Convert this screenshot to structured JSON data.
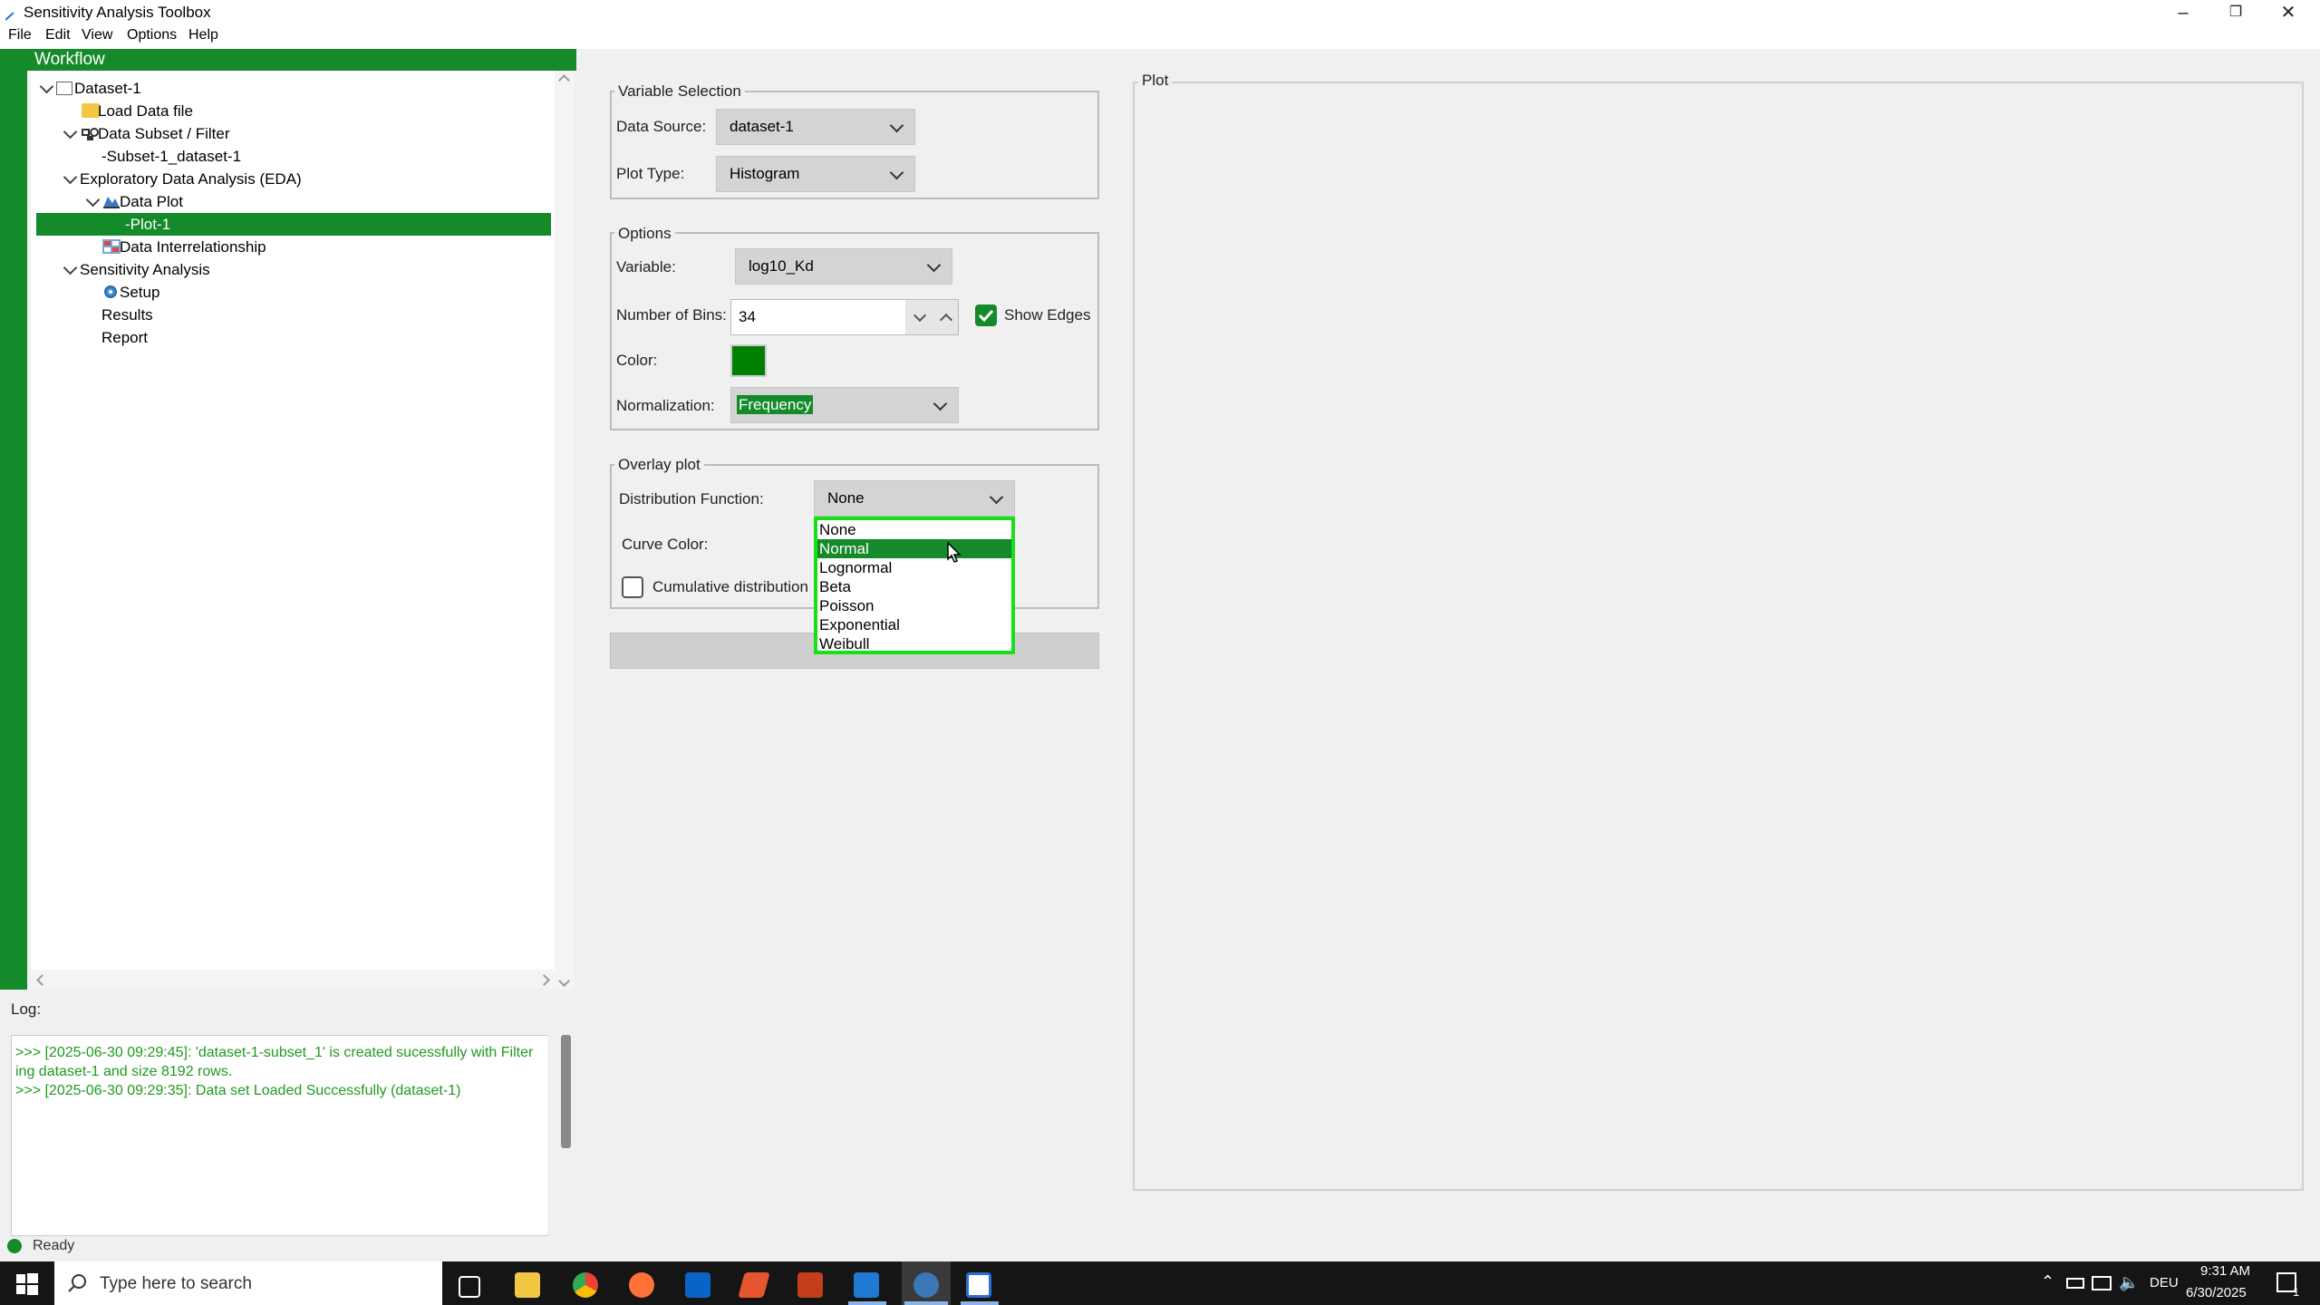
{
  "window": {
    "title": "Sensitivity Analysis Toolbox"
  },
  "menu": [
    "File",
    "Edit",
    "View",
    "Options",
    "Help"
  ],
  "workflow": {
    "header": "Workflow",
    "tree": [
      {
        "label": "Dataset-1"
      },
      {
        "label": "Load Data file"
      },
      {
        "label": "Data Subset / Filter"
      },
      {
        "label": "-Subset-1_dataset-1"
      },
      {
        "label": "Exploratory Data Analysis (EDA)"
      },
      {
        "label": "Data Plot"
      },
      {
        "label": "-Plot-1"
      },
      {
        "label": "Data Interrelationship"
      },
      {
        "label": "Sensitivity Analysis"
      },
      {
        "label": "Setup"
      },
      {
        "label": "Results"
      },
      {
        "label": "Report"
      }
    ],
    "selected": "-Plot-1"
  },
  "log": {
    "label": "Log:",
    "lines": [
      ">>> [2025-06-30 09:29:45]: 'dataset-1-subset_1' is created sucessfully with Filter",
      "ing dataset-1 and size 8192 rows.",
      ">>> [2025-06-30 09:29:35]: Data set Loaded Successfully (dataset-1)"
    ]
  },
  "status": {
    "text": "Ready"
  },
  "variable_selection": {
    "title": "Variable Selection",
    "data_source_label": "Data Source:",
    "data_source": "dataset-1",
    "plot_type_label": "Plot Type:",
    "plot_type": "Histogram"
  },
  "options": {
    "title": "Options",
    "variable_label": "Variable:",
    "variable": "log10_Kd",
    "bins_label": "Number of Bins:",
    "bins": "34",
    "show_edges_label": "Show Edges",
    "show_edges": true,
    "color_label": "Color:",
    "color": "#008000",
    "normalization_label": "Normalization:",
    "normalization": "Frequency"
  },
  "overlay": {
    "title": "Overlay plot",
    "distribution_label": "Distribution Function:",
    "distribution": "None",
    "curve_color_label": "Curve Color:",
    "cumulative_label": "Cumulative distribution",
    "cumulative": false,
    "dropdown_options": [
      "None",
      "Normal",
      "Lognormal",
      "Beta",
      "Poisson",
      "Exponential",
      "Weibull"
    ],
    "highlighted_option": "Normal"
  },
  "plot": {
    "title": "Plot"
  },
  "taskbar": {
    "search_placeholder": "Type here to search",
    "language": "DEU",
    "time": "9:31 AM",
    "date": "6/30/2025",
    "notifications": "1"
  },
  "colors": {
    "accent": "#158a2b",
    "dropdown_border": "#16e016",
    "log_text": "#1f9b1f"
  }
}
